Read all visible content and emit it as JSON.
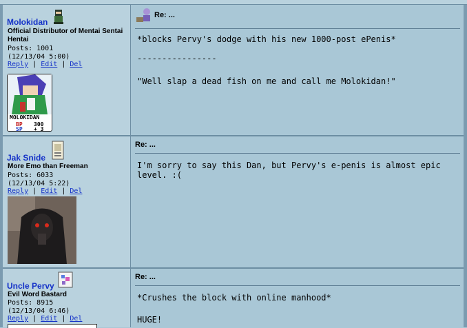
{
  "posts": [
    {
      "username": "Molokidan",
      "user_title": "Official Distributor of Mentai Sentai Hentai",
      "posts_label": "Posts: 1001",
      "timestamp": "(12/13/04 5:00)",
      "actions": [
        "Reply",
        "Edit",
        "Del"
      ],
      "subject": "Re: ...",
      "body_lines": [
        "*blocks Pervy's dodge with his new 1000-post ePenis*",
        "----------------",
        "\"Well slap a dead fish on me and call me Molokidan!\""
      ],
      "card": {
        "name": "MOLOKIDAN",
        "bp_label": "BP",
        "bp_value": "300",
        "sp_label": "SP",
        "sp_value": "+ 3"
      }
    },
    {
      "username": "Jak Snide",
      "user_title": "More Emo than Freeman",
      "posts_label": "Posts: 6033",
      "timestamp": "(12/13/04 5:22)",
      "actions": [
        "Reply",
        "Edit",
        "Del"
      ],
      "subject": "Re: ...",
      "body_lines": [
        "I'm sorry to say this Dan, but Pervy's e-penis is almost epic level. :("
      ]
    },
    {
      "username": "Uncle Pervy",
      "user_title": "Evil Word Bastard",
      "posts_label": "Posts: 8915",
      "timestamp": "(12/13/04 6:46)",
      "actions": [
        "Reply",
        "Edit",
        "Del"
      ],
      "subject": "Re: ...",
      "body_lines": [
        "*Crushes the block with online manhood*",
        "HUGE!"
      ]
    }
  ],
  "separator": "|"
}
